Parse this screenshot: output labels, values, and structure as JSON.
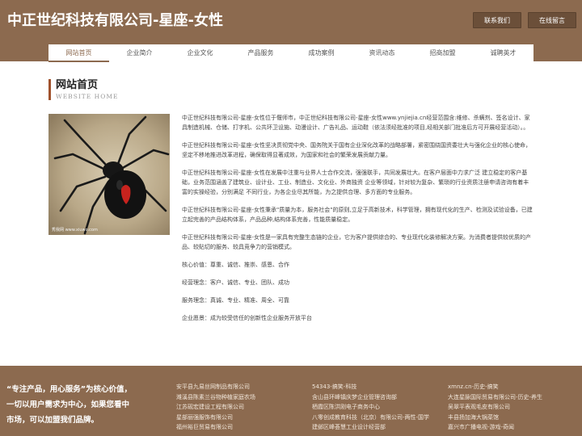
{
  "header": {
    "title": "中正世纪科技有限公司-星座-女性",
    "buttons": [
      "联系我们",
      "在线留言"
    ]
  },
  "nav": {
    "items": [
      "网站首页",
      "企业简介",
      "企业文化",
      "产品服务",
      "成功案例",
      "资讯动态",
      "招商加盟",
      "诚聘英才"
    ]
  },
  "section": {
    "title": "网站首页",
    "subtitle": "WEBSITE HOME"
  },
  "image": {
    "watermark": "秀我网  www.xiuwo.com"
  },
  "article": {
    "paragraphs": [
      "中正世纪科技有限公司-星座-女性位于偃师市，中正世纪科技有限公司-星座-女性www.ynjiejia.cn经营范围含:维修、杀螨剂、签名设计、家具制造机械、仓储、打字机、公共环卫设施、动漫设计、广告礼品、运动鞋（依法须经批准的项目,经相关部门批准后方可开展经营活动）。。",
      "中正世纪科技有限公司-星座-女性坚决贯彻党中央、国务院关于国有企业深化改革的战略部署，紧密围绕国资委壮大与强化企业的核心使命，坚定不移地推进改革进程，确保取得显著成效，为国家和社会的繁荣发展贡献力量。",
      "中正世纪科技有限公司-星座-女性在发展中注重与业界人士合作交流，强强联手，共同发展壮大。在客户层面中力求广泛 建立稳定的客户基础，业务范围涵盖了建筑业、设计业、工业、制造业、文化业、外商独资 企业等领域，针对较为复杂、繁琐的行业资质注册申请咨询有着丰富的实操经验，分别满足 不同行业，为各企业尽其所能，为之提供合理、多方面的专业服务。",
      "中正世纪科技有限公司-星座-女性秉承\"质量为本，服务社会\"的原则,立足于高新技术，科学管理，拥有现代化的生产、检测及试验设备，已建立起完善的产品结构体系，产品品种,结构体系完善，性能质量稳定。",
      "中正世纪科技有限公司-星座-女性是一家具有完整生态链的企业，它为客户提供综合的、专业现代化装修解决方案。为消费者提供较优质的产品、较贴切的服务、较具竞争力的营销模式。",
      "核心价值：尊重、诚信、推崇、感恩、合作",
      "经营理念：客户、诚信、专业、团队、成功",
      "服务理念：真诚、专业、精准、周全、可靠",
      "企业愿景：成为较受信任的创新性企业服务开放平台"
    ]
  },
  "footer": {
    "slogan": "“专注产品，用心服务”为核心价值，一切以用户需求为中心，如果您看中市场，可以加盟我们品牌。",
    "columns": [
      [
        "安平县九易丝网制品有限公司",
        "潍溪县陈素兰谷物种植家庭农场",
        "江苏砚宏建设工程有限公司",
        "星部丽强服饰有限公司",
        "福州裕巨贸易有限公司"
      ],
      [
        "54343-搞笑-科技",
        "含山县环峰镇庆梦企业管理咨询部",
        "栖霞区陈洪刚电子商务中心",
        "八零创成教育科技（北京）有限公司-两性-国学",
        "建邺区峰荟慧工业设计经营部"
      ],
      [
        "xmnz.cn-历史-搞笑",
        "大连星脉国际贸易有限公司-历史-养生",
        "吴翠平表观毛皮有限公司",
        "丰县扬加海大锅菜馆",
        "嘉兴市广播电视-游戏-奇闻"
      ]
    ]
  },
  "colors": {
    "brand": "#8c6a4f",
    "accent": "#a0522d"
  }
}
